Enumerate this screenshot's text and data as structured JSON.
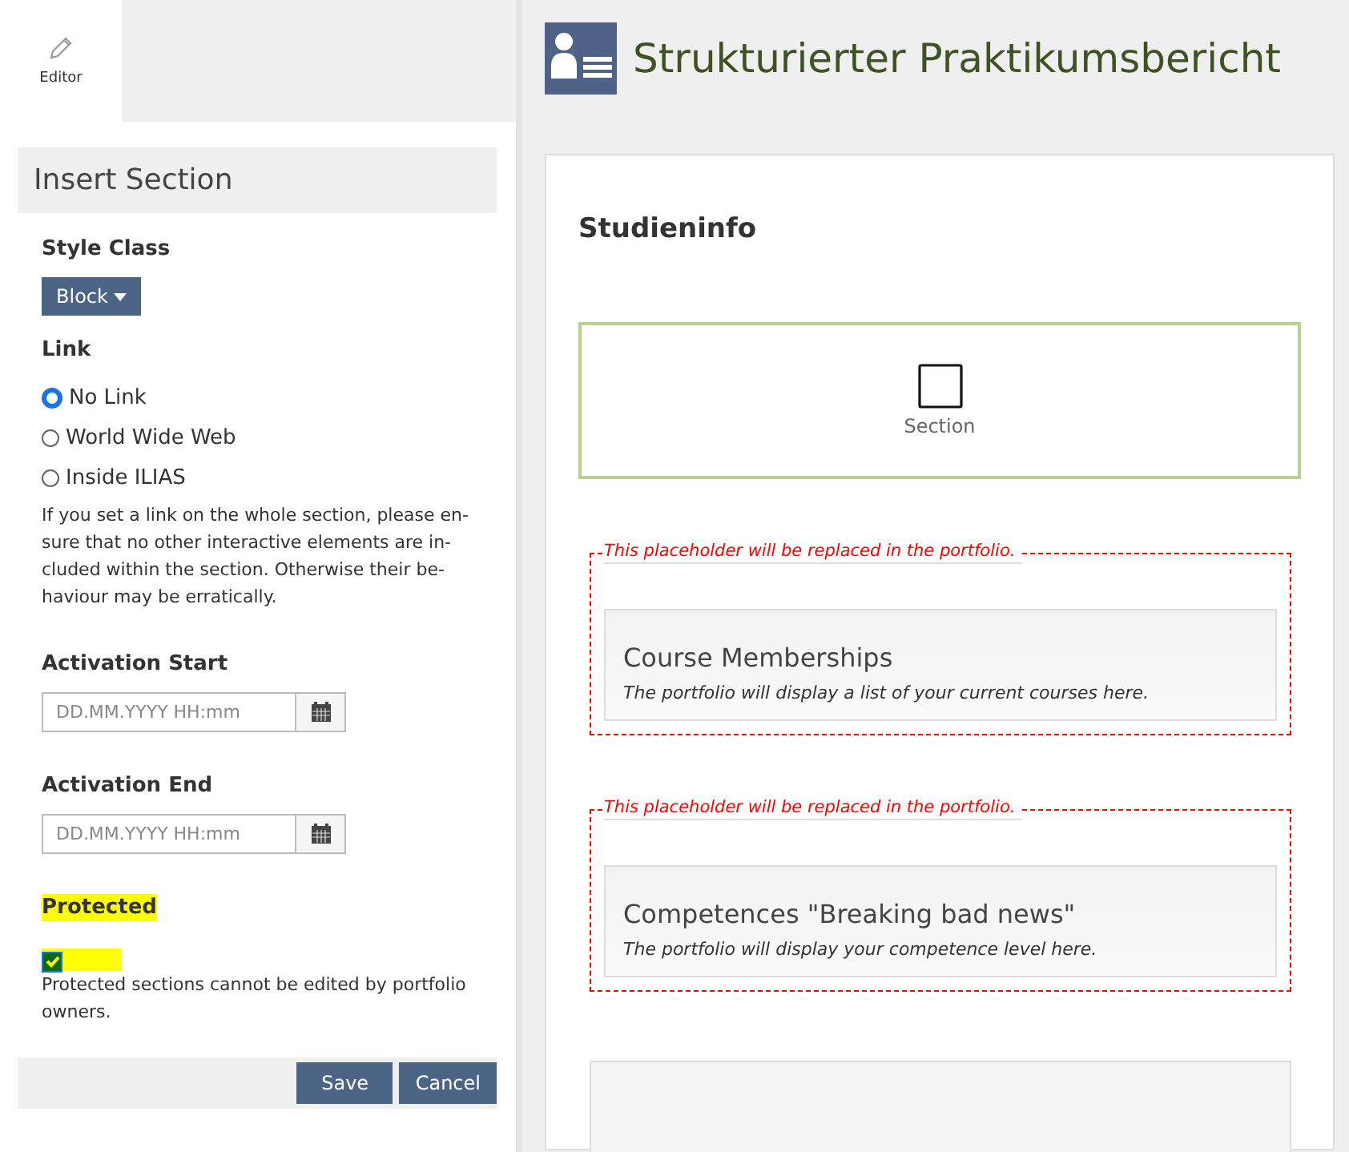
{
  "editor_tab": {
    "label": "Editor",
    "selected": true
  },
  "panel": {
    "title": "Insert Section",
    "style_class": {
      "label": "Style Class",
      "value": "Block"
    },
    "link": {
      "label": "Link",
      "options": [
        {
          "label": "No Link",
          "selected": true
        },
        {
          "label": "World Wide Web",
          "selected": false
        },
        {
          "label": "Inside ILIAS",
          "selected": false
        }
      ],
      "hint": "If you set a link on the whole section, please en-\nsure that no other interactive elements are in-\ncluded within the section. Otherwise their be-\nhaviour may be erratically."
    },
    "dates": [
      {
        "label": "Activation Start",
        "placeholder": "DD.MM.YYYY HH:mm"
      },
      {
        "label": "Activation End",
        "placeholder": "DD.MM.YYYY HH:mm"
      }
    ],
    "protected": {
      "label": "Protected",
      "checked": true,
      "highlighted": true,
      "hint": "Protected sections cannot be edited by portfolio owners."
    },
    "buttons": [
      "Save",
      "Cancel"
    ]
  },
  "page": {
    "title": "Strukturierter Praktikumsbericht",
    "heading": "Studieninfo",
    "section": {
      "label": "Section"
    },
    "placeholders": [
      {
        "note": "This placeholder will be replaced in the portfolio.",
        "title": "Course Memberships",
        "description": "The portfolio will display a list of your current courses here."
      },
      {
        "note": "This placeholder will be replaced in the portfolio.",
        "title": "Competences \"Breaking bad news\"",
        "description": "The portfolio will display your competence level here."
      }
    ],
    "trailing_cards": [
      {
        "kind": "card"
      }
    ]
  }
}
